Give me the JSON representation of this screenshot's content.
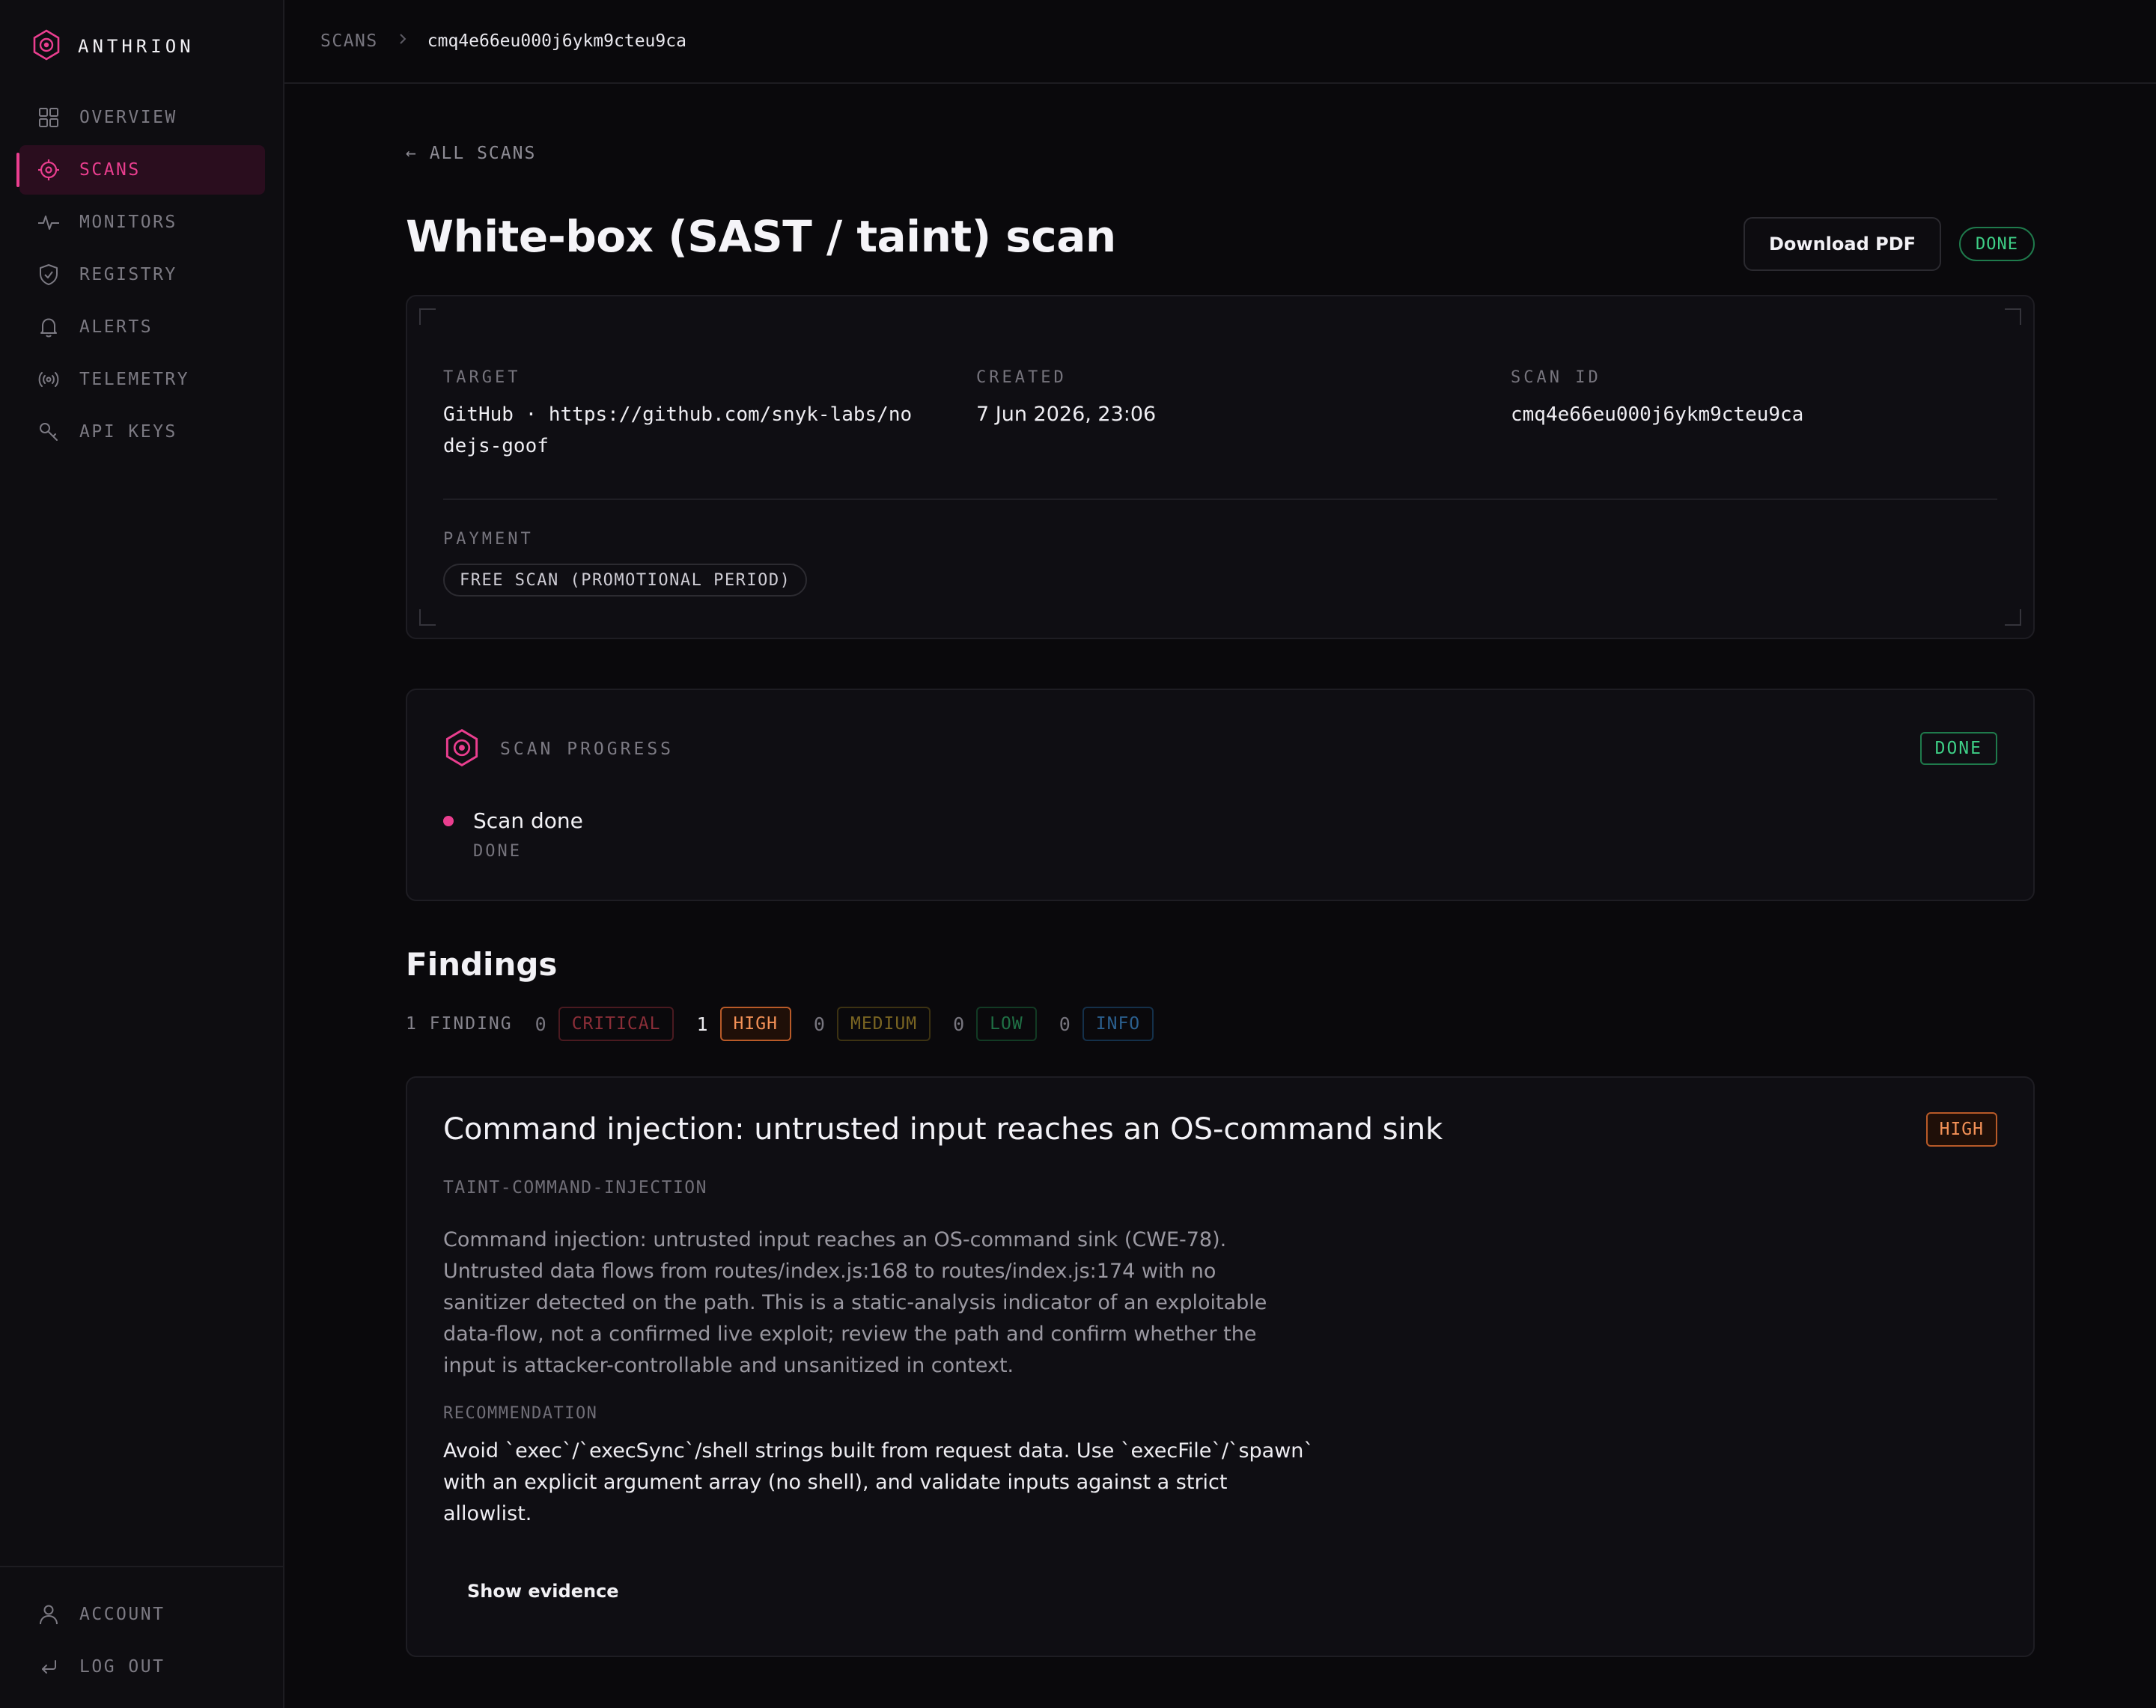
{
  "brand": {
    "name": "ANTHRION"
  },
  "sidebar": {
    "items": [
      {
        "label": "OVERVIEW",
        "icon": "grid-icon"
      },
      {
        "label": "SCANS",
        "icon": "crosshair-icon"
      },
      {
        "label": "MONITORS",
        "icon": "pulse-icon"
      },
      {
        "label": "REGISTRY",
        "icon": "shield-icon"
      },
      {
        "label": "ALERTS",
        "icon": "bell-icon"
      },
      {
        "label": "TELEMETRY",
        "icon": "broadcast-icon"
      },
      {
        "label": "API KEYS",
        "icon": "key-icon"
      }
    ],
    "bottom": [
      {
        "label": "ACCOUNT",
        "icon": "user-icon"
      },
      {
        "label": "LOG OUT",
        "icon": "logout-icon"
      }
    ]
  },
  "breadcrumb": {
    "parent": "SCANS",
    "current": "cmq4e66eu000j6ykm9cteu9ca"
  },
  "back_link": "← ALL SCANS",
  "page": {
    "title": "White-box (SAST / taint) scan",
    "download_label": "Download PDF",
    "status": "DONE"
  },
  "meta": {
    "target_label": "TARGET",
    "target_line1": "GitHub · https://github.com/snyk-labs/no",
    "target_line2": "dejs-goof",
    "created_label": "CREATED",
    "created_value": "7 Jun 2026, 23:06",
    "scan_id_label": "SCAN ID",
    "scan_id_value": "cmq4e66eu000j6ykm9cteu9ca",
    "payment_label": "PAYMENT",
    "payment_value": "FREE SCAN (PROMOTIONAL PERIOD)"
  },
  "progress": {
    "label": "SCAN PROGRESS",
    "status": "DONE",
    "step_title": "Scan done",
    "step_status": "DONE"
  },
  "findings": {
    "title": "Findings",
    "total": "1 FINDING",
    "counts": [
      {
        "count": "0",
        "label": "CRITICAL"
      },
      {
        "count": "1",
        "label": "HIGH"
      },
      {
        "count": "0",
        "label": "MEDIUM"
      },
      {
        "count": "0",
        "label": "LOW"
      },
      {
        "count": "0",
        "label": "INFO"
      }
    ],
    "items": [
      {
        "title": "Command injection: untrusted input reaches an OS-command sink",
        "severity": "HIGH",
        "rule": "TAINT-COMMAND-INJECTION",
        "desc_lines": [
          "Command injection: untrusted input reaches an OS-command sink (CWE-78).",
          "Untrusted data flows from routes/index.js:168 to routes/index.js:174 with no",
          "sanitizer detected on the path. This is a static-analysis indicator of an exploitable",
          "data-flow, not a confirmed live exploit; review the path and confirm whether the",
          "input is attacker-controllable and unsanitized in context."
        ],
        "rec_label": "RECOMMENDATION",
        "rec_lines": [
          "Avoid `exec`/`execSync`/shell strings built from request data. Use `execFile`/`spawn`",
          "with an explicit argument array (no shell), and validate inputs against a strict",
          "allowlist."
        ],
        "evidence_label": "Show evidence"
      }
    ]
  },
  "colors": {
    "accent": "#ea3e8f",
    "done_green": "#3ecf86",
    "high_orange": "#f39157",
    "background": "#0a090c"
  }
}
